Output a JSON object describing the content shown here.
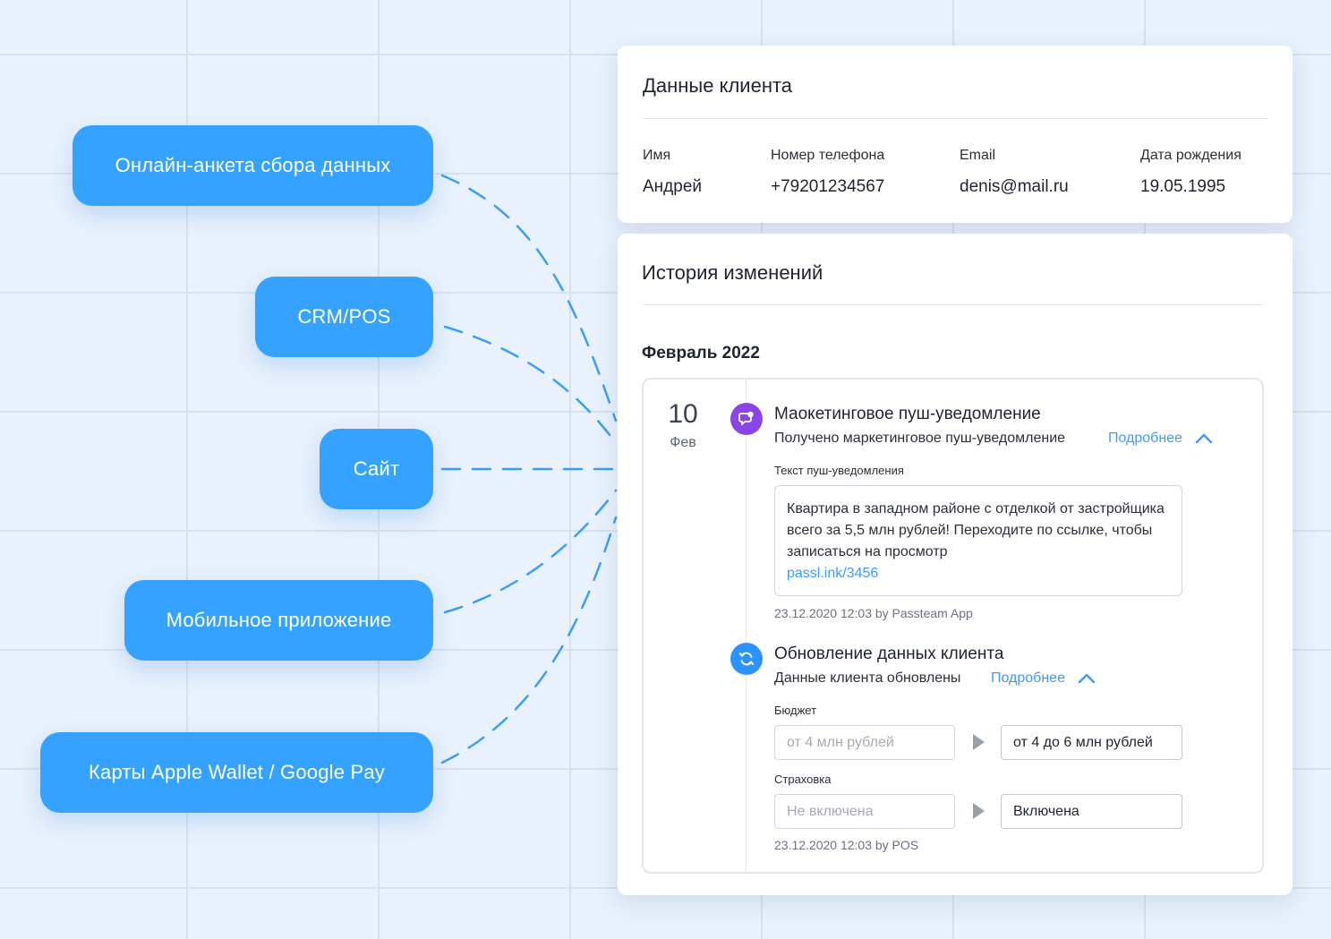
{
  "sources": [
    {
      "label": "Онлайн-анкета сбора данных"
    },
    {
      "label": "CRM/POS"
    },
    {
      "label": "Сайт"
    },
    {
      "label": "Мобильное приложение"
    },
    {
      "label": "Карты Apple Wallet / Google Pay"
    }
  ],
  "client": {
    "title": "Данные клиента",
    "fields": [
      {
        "label": "Имя",
        "value": "Андрей"
      },
      {
        "label": "Номер телефона",
        "value": "+79201234567"
      },
      {
        "label": "Email",
        "value": "denis@mail.ru"
      },
      {
        "label": "Дата рождения",
        "value": "19.05.1995"
      }
    ]
  },
  "history": {
    "title": "История изменений",
    "month": "Февраль 2022",
    "day": "10",
    "day_month": "Фев",
    "events": [
      {
        "icon": "push-notification-icon",
        "icon_color": "#8b44e6",
        "title": "Маокетинговое пуш-уведомление",
        "subtitle": "Получено маркетинговое пуш-уведомление",
        "more": "Подробнее",
        "field_label": "Текст пуш-уведомления",
        "message": "Квартира в западном районе с отделкой от застройщика всего за 5,5 млн рублей! Переходите по ссылке, чтобы записаться на просмотр",
        "link": "passl.ink/3456",
        "meta": "23.12.2020 12:03 by Passteam App"
      },
      {
        "icon": "refresh-icon",
        "icon_color": "#2b93ff",
        "title": "Обновление данных клиента",
        "subtitle": "Данные клиента обновлены",
        "more": "Подробнее",
        "changes": [
          {
            "label": "Бюджет",
            "old": "от 4 млн рублей",
            "new": "от 4 до 6 млн рублей"
          },
          {
            "label": "Страховка",
            "old": "Не включена",
            "new": "Включена"
          }
        ],
        "meta": "23.12.2020 12:03 by POS"
      }
    ]
  },
  "colors": {
    "accent": "#36a2ff",
    "link": "#3d9bff"
  }
}
